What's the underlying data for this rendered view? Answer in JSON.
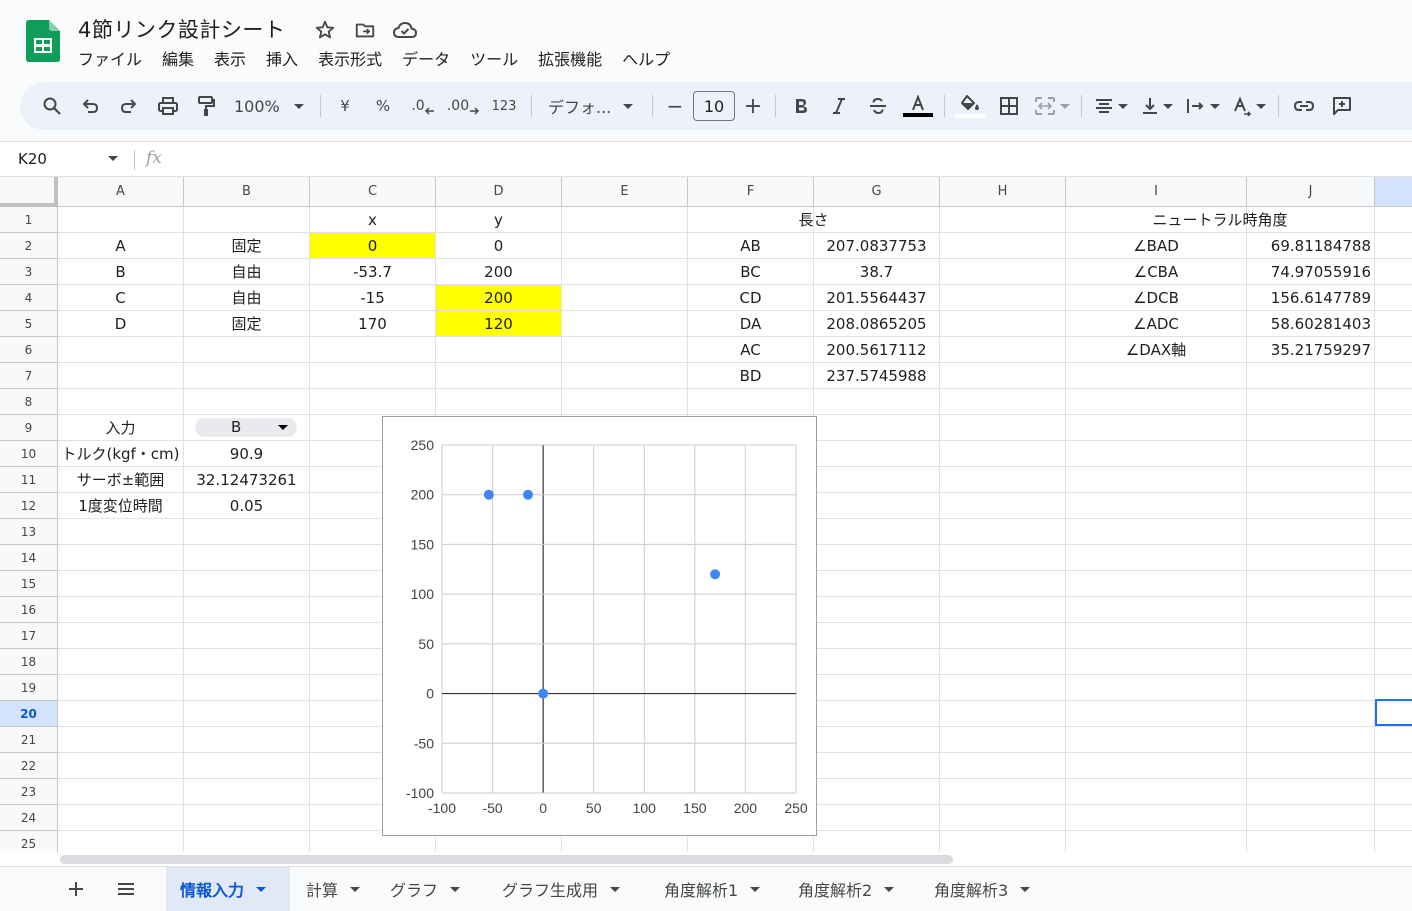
{
  "app": {
    "title": "4節リンク設計シート",
    "menu": [
      "ファイル",
      "編集",
      "表示",
      "挿入",
      "表示形式",
      "データ",
      "ツール",
      "拡張機能",
      "ヘルプ"
    ]
  },
  "toolbar": {
    "zoom": "100%",
    "currency": "¥",
    "percent": "%",
    "decimal_decrease": ".0",
    "decimal_increase": ".00",
    "number_format": "123",
    "font": "デフォ...",
    "font_size": "10",
    "minus": "−",
    "plus": "+"
  },
  "formula_bar": {
    "cell_ref": "K20",
    "fx": "fx"
  },
  "columns": [
    "A",
    "B",
    "C",
    "D",
    "E",
    "F",
    "G",
    "H",
    "I",
    "J"
  ],
  "rows": [
    "1",
    "2",
    "3",
    "4",
    "5",
    "6",
    "7",
    "8",
    "9",
    "10",
    "11",
    "12",
    "13",
    "14",
    "15",
    "16",
    "17",
    "18",
    "19",
    "20",
    "21",
    "22",
    "23",
    "24",
    "25"
  ],
  "cells": {
    "C1": "x",
    "D1": "y",
    "F1": "長さ",
    "I1": "ニュートラル時角度",
    "A2": "A",
    "B2": "固定",
    "C2": "0",
    "D2": "0",
    "F2": "AB",
    "G2": "207.0837753",
    "I2": "∠BAD",
    "J2": "69.81184788",
    "A3": "B",
    "B3": "自由",
    "C3": "-53.7",
    "D3": "200",
    "F3": "BC",
    "G3": "38.7",
    "I3": "∠CBA",
    "J3": "74.97055916",
    "A4": "C",
    "B4": "自由",
    "C4": "-15",
    "D4": "200",
    "F4": "CD",
    "G4": "201.5564437",
    "I4": "∠DCB",
    "J4": "156.6147789",
    "A5": "D",
    "B5": "固定",
    "C5": "170",
    "D5": "120",
    "F5": "DA",
    "G5": "208.0865205",
    "I5": "∠ADC",
    "J5": "58.60281403",
    "F6": "AC",
    "G6": "200.5617112",
    "I6": "∠DAX軸",
    "J6": "35.21759297",
    "F7": "BD",
    "G7": "237.5745988",
    "A9": "入力",
    "B9": "B",
    "A10": "トルク(kgf・cm)",
    "B10": "90.9",
    "A11": "サーボ±範囲",
    "B11": "32.12473261",
    "A12": "1度変位時間",
    "B12": "0.05"
  },
  "chart_data": {
    "type": "scatter",
    "x": [
      0,
      -53.7,
      -15,
      170
    ],
    "y": [
      0,
      200,
      200,
      120
    ],
    "xlim": [
      -100,
      250
    ],
    "ylim": [
      -100,
      250
    ],
    "xticks": [
      -100,
      -50,
      0,
      50,
      100,
      150,
      200,
      250
    ],
    "yticks": [
      -100,
      -50,
      0,
      50,
      100,
      150,
      200,
      250
    ],
    "grid": true,
    "point_color": "#4285f4"
  },
  "sheets": [
    {
      "label": "情報入力",
      "active": true
    },
    {
      "label": "計算",
      "active": false
    },
    {
      "label": "グラフ",
      "active": false
    },
    {
      "label": "グラフ生成用",
      "active": false
    },
    {
      "label": "角度解析1",
      "active": false
    },
    {
      "label": "角度解析2",
      "active": false
    },
    {
      "label": "角度解析3",
      "active": false
    }
  ],
  "colors": {
    "accent": "#0b57d0",
    "highlight": "#ffff00",
    "sheets_green": "#0f9d58"
  }
}
